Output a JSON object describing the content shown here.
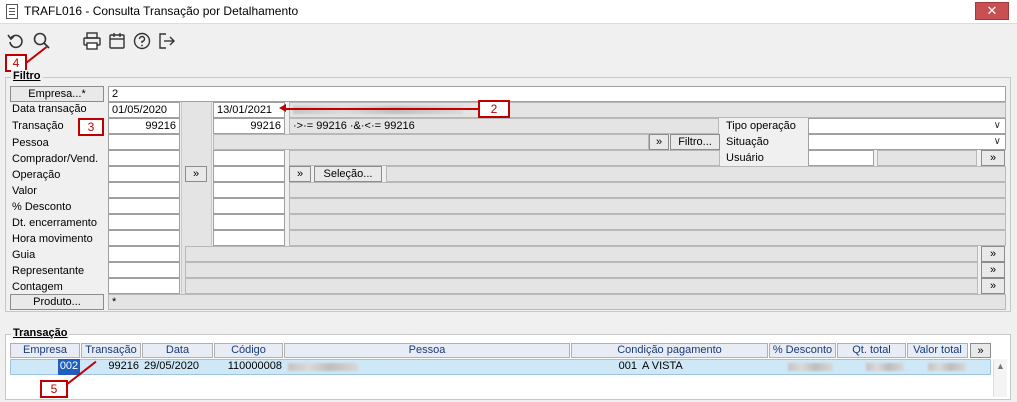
{
  "window": {
    "title": "TRAFL016 - Consulta Transação por Detalhamento",
    "close_glyph": "✕"
  },
  "toolbar": {
    "icons": [
      "refresh-icon",
      "search-icon",
      "print-icon",
      "calendar-icon",
      "help-icon",
      "exit-icon"
    ]
  },
  "annotations": {
    "c1": "4",
    "c2": "2",
    "c3": "3",
    "c4": "5",
    "color": "#c00000"
  },
  "filtro": {
    "label": "Filtro",
    "empresa_button": "Empresa...*",
    "empresa_value": "2",
    "rows": {
      "data_transacao": "Data transação",
      "transacao": "Transação",
      "pessoa": "Pessoa",
      "comprador": "Comprador/Vend.",
      "operacao": "Operação",
      "valor": "Valor",
      "desconto": "% Desconto",
      "encerramento": "Dt. encerramento",
      "hora": "Hora movimento",
      "guia": "Guia",
      "representante": "Representante",
      "contagem": "Contagem"
    },
    "data_from": "01/05/2020",
    "data_to": "13/01/2021",
    "transacao_from": "99216",
    "transacao_to": "99216",
    "transacao_expr": "·>·= 99216 ·&·<·= 99216",
    "more_glyph": "»",
    "filtro_button": "Filtro...",
    "selecao_button": "Seleção...",
    "produto_button": "Produto...",
    "produto_value": "*",
    "tipo_operacao": "Tipo operação",
    "situacao": "Situação",
    "usuario": "Usuário",
    "dropdown_glyph": "∨"
  },
  "transacao": {
    "label": "Transação",
    "columns": [
      "Empresa",
      "Transação",
      "Data",
      "Código",
      "Pessoa",
      "Condição pagamento",
      "% Desconto",
      "Qt. total",
      "Valor total"
    ],
    "more_glyph": "»",
    "row": {
      "empresa": "002",
      "transacao": "99216",
      "data": "29/05/2020",
      "codigo": "110000008",
      "cond_codigo": "001",
      "cond_desc": "A VISTA"
    }
  }
}
